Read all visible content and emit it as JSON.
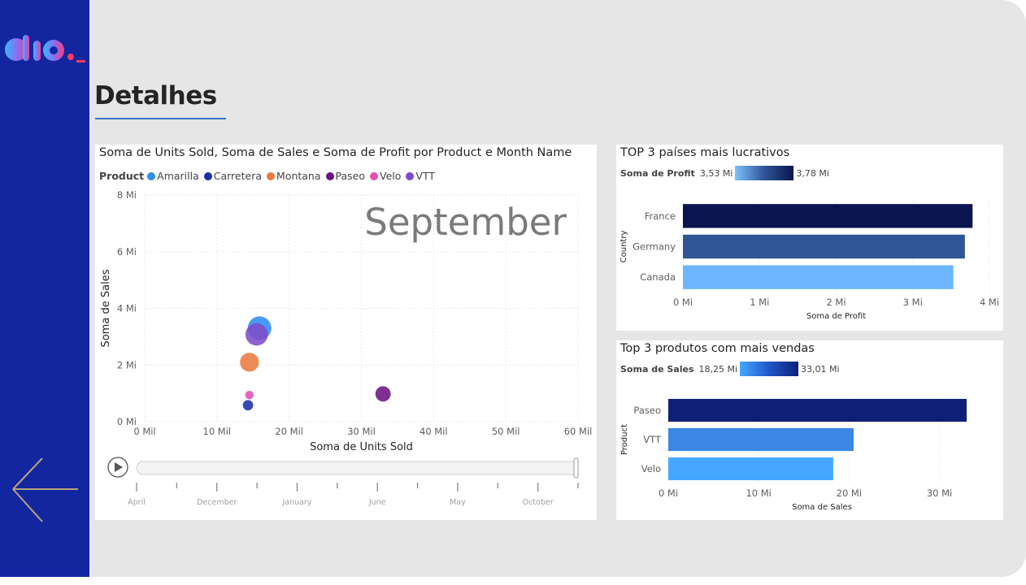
{
  "page": {
    "title": "Detalhes"
  },
  "colors": {
    "sidebar": "#1226a0",
    "canvas": "#e6e6e6",
    "accent": "#3a78c9"
  },
  "nav": {
    "back_icon": "arrow-left-icon",
    "logo_icon": "dio-logo-icon"
  },
  "scatter": {
    "title": "Soma de Units Sold, Soma de Sales e Soma de Profit por Product e Month Name",
    "legend_label": "Product",
    "legend": [
      {
        "name": "Amarilla",
        "color": "#2b8ef0"
      },
      {
        "name": "Carretera",
        "color": "#1a2fa8"
      },
      {
        "name": "Montana",
        "color": "#ec7a3f"
      },
      {
        "name": "Paseo",
        "color": "#6b1283"
      },
      {
        "name": "Velo",
        "color": "#e44fb4"
      },
      {
        "name": "VTT",
        "color": "#7e4cc9"
      }
    ],
    "watermark": "September",
    "play_icon": "play-icon",
    "timeline": [
      "April",
      "December",
      "January",
      "June",
      "May",
      "October"
    ]
  },
  "chart_data": [
    {
      "type": "scatter",
      "title": "Soma de Units Sold, Soma de Sales e Soma de Profit por Product e Month Name",
      "xlabel": "Soma de Units Sold",
      "ylabel": "Soma de Sales",
      "xlim": [
        0,
        60000
      ],
      "ylim": [
        0,
        8000000
      ],
      "x_ticks": [
        "0 Mil",
        "10 Mil",
        "20 Mil",
        "30 Mil",
        "40 Mil",
        "50 Mil",
        "60 Mil"
      ],
      "y_ticks": [
        "0 Mi",
        "2 Mi",
        "4 Mi",
        "6 Mi",
        "8 Mi"
      ],
      "grid": true,
      "series": [
        {
          "name": "Amarilla",
          "x": 15900,
          "y": 3300000,
          "size": 1.0
        },
        {
          "name": "VTT",
          "x": 15500,
          "y": 3080000,
          "size": 0.95
        },
        {
          "name": "Montana",
          "x": 14500,
          "y": 2100000,
          "size": 0.8
        },
        {
          "name": "Paseo",
          "x": 33000,
          "y": 980000,
          "size": 0.65
        },
        {
          "name": "Velo",
          "x": 14500,
          "y": 940000,
          "size": 0.36
        },
        {
          "name": "Carretera",
          "x": 14300,
          "y": 580000,
          "size": 0.44
        }
      ]
    },
    {
      "type": "bar",
      "orientation": "horizontal",
      "title": "TOP 3 países mais lucrativos",
      "xlabel": "Soma de Profit",
      "ylabel": "Country",
      "xlim": [
        0,
        4000000
      ],
      "x_ticks": [
        "0 Mi",
        "1 Mi",
        "2 Mi",
        "3 Mi",
        "4 Mi"
      ],
      "categories": [
        "France",
        "Germany",
        "Canada"
      ],
      "values": [
        3780000,
        3680000,
        3530000
      ],
      "colors": [
        "#0a1550",
        "#2f5597",
        "#6db6ff"
      ],
      "legend_label": "Soma de Profit",
      "legend_min": "3,53 Mi",
      "legend_max": "3,78 Mi"
    },
    {
      "type": "bar",
      "orientation": "horizontal",
      "title": "Top 3 produtos com mais vendas",
      "xlabel": "Soma de Sales",
      "ylabel": "Product",
      "xlim": [
        0,
        34000000
      ],
      "x_ticks": [
        "0 Mi",
        "10 Mi",
        "20 Mi",
        "30 Mi"
      ],
      "categories": [
        "Paseo",
        "VTT",
        "Velo"
      ],
      "values": [
        33010000,
        20510000,
        18250000
      ],
      "colors": [
        "#0f1f78",
        "#3b87e6",
        "#45a7ff"
      ],
      "legend_label": "Soma de  Sales",
      "legend_min": "18,25 Mi",
      "legend_max": "33,01 Mi"
    }
  ]
}
